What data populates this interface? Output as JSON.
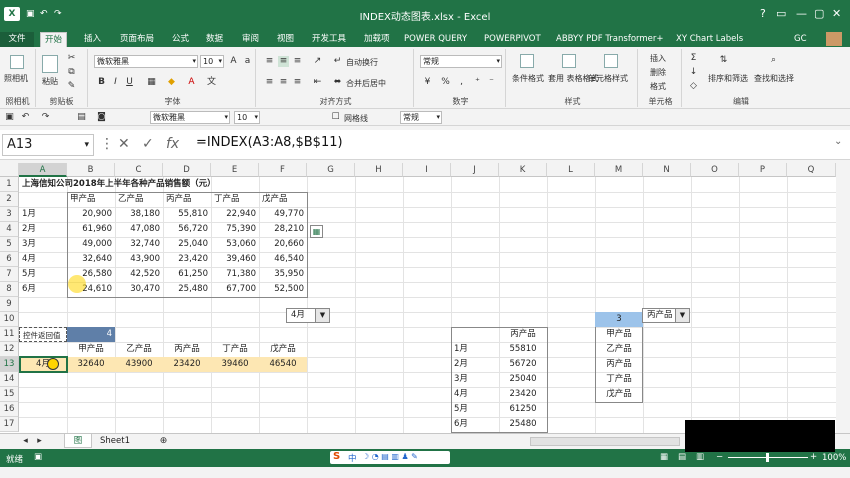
{
  "window": {
    "title": "INDEX动态图表.xlsx - Excel",
    "app_badge": "X",
    "user": "GC"
  },
  "tabs": [
    "文件",
    "开始",
    "插入",
    "页面布局",
    "公式",
    "数据",
    "审阅",
    "视图",
    "开发工具",
    "加载项",
    "POWER QUERY",
    "POWERPIVOT",
    "ABBYY PDF Transformer+",
    "XY Chart Labels"
  ],
  "ribbon": {
    "clipboard": {
      "label": "剪贴板",
      "paste": "粘贴",
      "cam": "照相机",
      "cam_label": "照相机"
    },
    "font": {
      "label": "字体",
      "name": "微软雅黑",
      "size": "10"
    },
    "align": {
      "label": "对齐方式",
      "wrap": "自动换行",
      "merge": "合并后居中"
    },
    "number": {
      "label": "数字",
      "format": "常规"
    },
    "styles": {
      "label": "样式",
      "cond": "条件格式",
      "table": "套用\n表格格式",
      "cell": "单元格样式"
    },
    "cells": {
      "label": "单元格",
      "insert": "插入",
      "delete": "删除",
      "format": "格式"
    },
    "edit": {
      "label": "编辑",
      "sort": "排序和筛选",
      "find": "查找和选择"
    }
  },
  "qbar": {
    "font": "微软雅黑",
    "size": "10",
    "gridlines": "网格线",
    "format": "常规"
  },
  "formula_bar": {
    "namebox": "A13",
    "fx": "fx",
    "formula": "=INDEX(A3:A8,$B$11)"
  },
  "columns": [
    "A",
    "B",
    "C",
    "D",
    "E",
    "F",
    "G",
    "H",
    "I",
    "J",
    "K",
    "L",
    "M",
    "N",
    "O",
    "P",
    "Q"
  ],
  "rows": [
    "1",
    "2",
    "3",
    "4",
    "5",
    "6",
    "7",
    "8",
    "9",
    "10",
    "11",
    "12",
    "13",
    "14",
    "15",
    "16",
    "17"
  ],
  "sheet": {
    "title": "上海信知公司2018年上半年各种产品销售额（元）",
    "headers": [
      "甲产品",
      "乙产品",
      "丙产品",
      "丁产品",
      "戊产品"
    ],
    "data": [
      [
        "1月",
        "20,900",
        "38,180",
        "55,810",
        "22,940",
        "49,770"
      ],
      [
        "2月",
        "61,960",
        "47,080",
        "56,720",
        "75,390",
        "28,210"
      ],
      [
        "3月",
        "49,000",
        "32,740",
        "25,040",
        "53,060",
        "20,660"
      ],
      [
        "4月",
        "32,640",
        "43,900",
        "23,420",
        "39,460",
        "46,540"
      ],
      [
        "5月",
        "26,580",
        "42,520",
        "61,250",
        "71,380",
        "35,950"
      ],
      [
        "6月",
        "24,610",
        "30,470",
        "25,480",
        "67,700",
        "52,500"
      ]
    ],
    "dropdown_month": "4月",
    "control_label": "控件返回值",
    "control_value": "4",
    "row12_headers": [
      "甲产品",
      "乙产品",
      "丙产品",
      "丁产品",
      "戊产品"
    ],
    "row13": [
      "4月",
      "32640",
      "43900",
      "23420",
      "39460",
      "46540"
    ],
    "side_table": {
      "header": "丙产品",
      "rows": [
        [
          "1月",
          "55810"
        ],
        [
          "2月",
          "56720"
        ],
        [
          "3月",
          "25040"
        ],
        [
          "4月",
          "23420"
        ],
        [
          "5月",
          "61250"
        ],
        [
          "6月",
          "25480"
        ]
      ]
    },
    "list_value": "3",
    "list_items": [
      "甲产品",
      "乙产品",
      "丙产品",
      "丁产品",
      "戊产品"
    ],
    "product_dropdown": "丙产品"
  },
  "sheet_tabs": [
    "图",
    "Sheet1"
  ],
  "status": {
    "ready": "就绪",
    "zoom": "100%"
  }
}
